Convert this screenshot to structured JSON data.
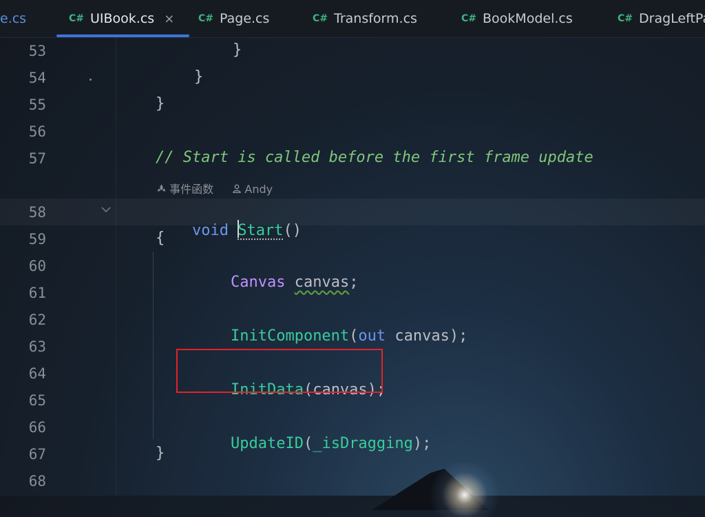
{
  "tabs": [
    {
      "name": "e.cs",
      "show_icon": false
    },
    {
      "name": "UIBook.cs",
      "active": true,
      "close": "×"
    },
    {
      "name": "Page.cs"
    },
    {
      "name": "Transform.cs"
    },
    {
      "name": "BookModel.cs"
    },
    {
      "name": "DragLeftPa"
    }
  ],
  "tab_icon": "C#",
  "line_numbers": [
    "53",
    "54",
    "55",
    "56",
    "57",
    "58",
    "59",
    "60",
    "61",
    "62",
    "63",
    "64",
    "65",
    "66",
    "67",
    "68"
  ],
  "code": {
    "l53": "}",
    "l54": "}",
    "l55": "}",
    "l57_comment": "// Start is called before the first frame update",
    "hint_event": "事件函数",
    "hint_author": "Andy",
    "l58_kw": "void",
    "l58_fn": "Start",
    "l58_rest": "()",
    "l59": "{",
    "l60_type": "Canvas",
    "l60_var": "canvas",
    "l60_end": ";",
    "l62_fn": "InitComponent",
    "l62_open": "(",
    "l62_kw": "out",
    "l62_rest": " canvas);",
    "l64_fn": "InitData",
    "l64_rest": "(canvas);",
    "l66_fn": "UpdateID",
    "l66_open": "(",
    "l66_arg": "_isDragging",
    "l66_close": ");",
    "l67": "}"
  },
  "colors": {
    "comment": "#7ec77a",
    "keyword": "#6c95eb",
    "type": "#c191ff",
    "function": "#39cc9b",
    "highlight_box": "#e0242b",
    "active_tab_underline": "#3d74d6"
  },
  "icons": {
    "tab_icon": "csharp-file-icon",
    "close": "close-icon",
    "fold": "chevron-down-icon",
    "event": "unity-event-icon",
    "author": "person-icon"
  }
}
